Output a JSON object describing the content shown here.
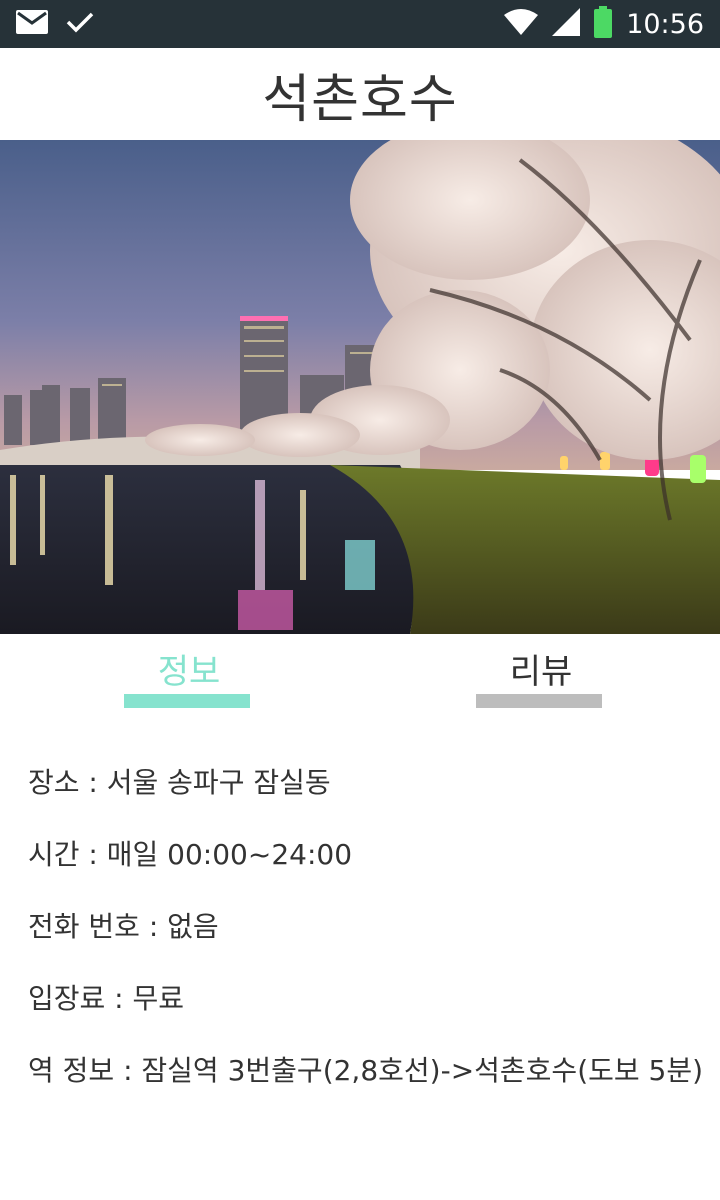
{
  "status_bar": {
    "time": "10:56",
    "left_icons": [
      "mail-icon",
      "check-icon"
    ],
    "right_icons": [
      "wifi-icon",
      "signal-icon",
      "battery-icon"
    ],
    "battery_color": "#4CD964",
    "background": "#263238"
  },
  "header": {
    "title": "석촌호수"
  },
  "hero": {
    "image": "night-lake-cherry-blossom-photo"
  },
  "tabs": [
    {
      "label": "정보",
      "active": true,
      "color": "#86E3CE"
    },
    {
      "label": "리뷰",
      "active": false,
      "color": "#BDBDBD"
    }
  ],
  "info": {
    "rows": [
      "장소 :  서울 송파구 잠실동",
      "시간 : 매일 00:00~24:00",
      "전화 번호 :  없음",
      "입장료 : 무료",
      "역 정보 :  잠실역 3번출구(2,8호선)->석촌호수(도보 5분)"
    ]
  }
}
